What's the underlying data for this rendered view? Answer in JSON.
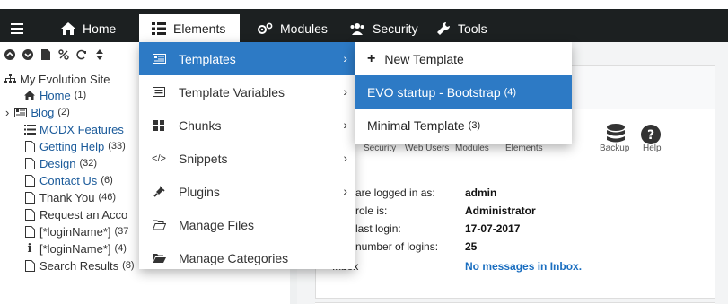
{
  "nav": {
    "home": "Home",
    "elements": "Elements",
    "modules": "Modules",
    "security": "Security",
    "tools": "Tools"
  },
  "tree": {
    "site_name": "My Evolution Site",
    "nodes": [
      {
        "label": "Home",
        "count": "(1)"
      },
      {
        "label": "Blog",
        "count": "(2)"
      },
      {
        "label": "MODX Features",
        "count": ""
      },
      {
        "label": "Getting Help",
        "count": "(33)"
      },
      {
        "label": "Design",
        "count": "(32)"
      },
      {
        "label": "Contact Us",
        "count": "(6)"
      },
      {
        "label": "Thank You",
        "count": "(46)"
      },
      {
        "label": "Request an Acco",
        "count": ""
      },
      {
        "label": "[*loginName*]",
        "count": "(37"
      },
      {
        "label": "[*loginName*]",
        "count": "(4)"
      },
      {
        "label": "Search Results",
        "count": "(8)"
      }
    ]
  },
  "elements_menu": {
    "items": [
      {
        "label": "Templates"
      },
      {
        "label": "Template Variables"
      },
      {
        "label": "Chunks"
      },
      {
        "label": "Snippets"
      },
      {
        "label": "Plugins"
      },
      {
        "label": "Manage Files"
      },
      {
        "label": "Manage Categories"
      }
    ]
  },
  "templates_menu": {
    "items": [
      {
        "label": "New Template",
        "count": ""
      },
      {
        "label": "EVO startup - Bootstrap",
        "count": "(4)"
      },
      {
        "label": "Minimal Template",
        "count": "(3)"
      }
    ]
  },
  "main": {
    "tool_labels": [
      "Security",
      "Web Users",
      "Modules",
      "Elements",
      "Backup",
      "Help"
    ],
    "info": {
      "logged_in_key": "are logged in as:",
      "logged_in_val": "admin",
      "role_key": "role is:",
      "role_val": "Administrator",
      "last_login_key": "last login:",
      "last_login_val": "17-07-2017",
      "num_logins_key": "number of logins:",
      "num_logins_val": "25",
      "inbox_key": "Inbox",
      "inbox_val": "No messages in Inbox."
    }
  },
  "colors": {
    "topbar": "#1c2021",
    "accent": "#2d7ac5",
    "link": "#1a5a9a"
  }
}
